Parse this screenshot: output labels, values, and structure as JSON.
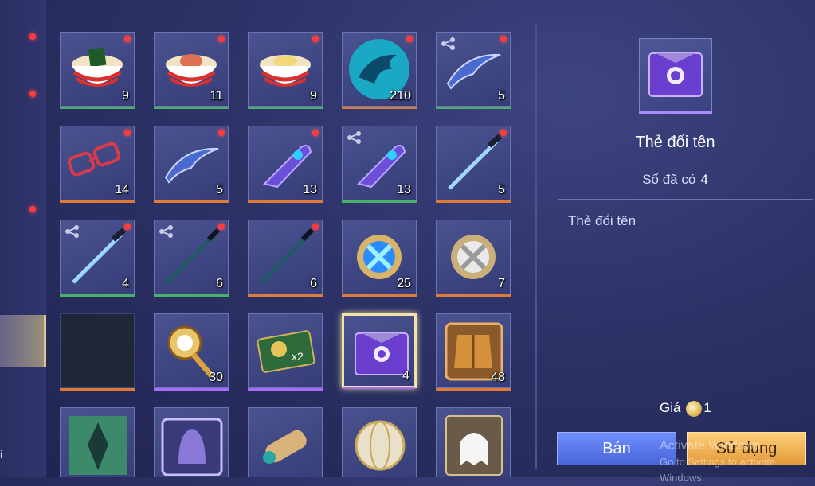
{
  "sidebar": {
    "letter": "i"
  },
  "items": [
    {
      "count": "9",
      "bar": "#4caf6a",
      "dot": true,
      "share": false,
      "icon": "seaweed-noodle-bowl-icon"
    },
    {
      "count": "11",
      "bar": "#4caf6a",
      "dot": true,
      "share": false,
      "icon": "salmon-noodle-bowl-icon"
    },
    {
      "count": "9",
      "bar": "#4caf6a",
      "dot": true,
      "share": false,
      "icon": "egg-noodle-bowl-icon"
    },
    {
      "count": "210",
      "bar": "#e07a3a",
      "dot": true,
      "share": false,
      "icon": "dragon-emblem-icon"
    },
    {
      "count": "5",
      "bar": "#4caf6a",
      "dot": true,
      "share": true,
      "icon": "curved-blade-icon"
    },
    {
      "count": "14",
      "bar": "#e07a3a",
      "dot": true,
      "share": false,
      "icon": "red-glasses-icon"
    },
    {
      "count": "5",
      "bar": "#e07a3a",
      "dot": true,
      "share": false,
      "icon": "curved-blade-icon"
    },
    {
      "count": "13",
      "bar": "#e07a3a",
      "dot": true,
      "share": false,
      "icon": "earpiece-icon"
    },
    {
      "count": "13",
      "bar": "#4caf6a",
      "dot": false,
      "share": true,
      "icon": "earpiece-icon"
    },
    {
      "count": "5",
      "bar": "#e07a3a",
      "dot": true,
      "share": false,
      "icon": "sword-icon"
    },
    {
      "count": "4",
      "bar": "#4caf6a",
      "dot": true,
      "share": true,
      "icon": "sword-icon"
    },
    {
      "count": "6",
      "bar": "#4caf6a",
      "dot": true,
      "share": true,
      "icon": "dark-blade-icon"
    },
    {
      "count": "6",
      "bar": "#e07a3a",
      "dot": true,
      "share": false,
      "icon": "dark-blade-icon"
    },
    {
      "count": "25",
      "bar": "#e07a3a",
      "dot": false,
      "share": false,
      "icon": "blue-orb-icon"
    },
    {
      "count": "7",
      "bar": "#e07a3a",
      "dot": false,
      "share": false,
      "icon": "silver-orb-icon"
    },
    {
      "count": "",
      "bar": "#e07a3a",
      "dot": false,
      "share": false,
      "icon": "empty-slot",
      "empty": true
    },
    {
      "count": "30",
      "bar": "#a86bff",
      "dot": false,
      "share": false,
      "icon": "golden-scepter-icon"
    },
    {
      "count": "",
      "bar": "#a86bff",
      "dot": false,
      "share": false,
      "icon": "coin-ticket-x2-icon",
      "label": "x2"
    },
    {
      "count": "4",
      "bar": "#a86bff",
      "dot": false,
      "share": false,
      "icon": "rename-card-icon",
      "selected": true
    },
    {
      "count": "48",
      "bar": "#e07a3a",
      "dot": false,
      "share": false,
      "icon": "armor-chest-icon"
    },
    {
      "count": "",
      "bar": "#e07a3a",
      "dot": false,
      "share": false,
      "icon": "green-emblem-icon"
    },
    {
      "count": "",
      "bar": "#e07a3a",
      "dot": false,
      "share": false,
      "icon": "knight-helmet-icon"
    },
    {
      "count": "",
      "bar": "#e07a3a",
      "dot": false,
      "share": false,
      "icon": "scroll-icon"
    },
    {
      "count": "",
      "bar": "#e07a3a",
      "dot": false,
      "share": false,
      "icon": "globe-orb-icon"
    },
    {
      "count": "",
      "bar": "#e07a3a",
      "dot": false,
      "share": false,
      "icon": "ghost-card-icon"
    }
  ],
  "detail": {
    "title": "Thẻ đổi tên",
    "owned_label": "Số đã có",
    "owned_value": "4",
    "description": "Thẻ đổi tên",
    "price_label": "Giá",
    "price_value": "1"
  },
  "buttons": {
    "sell": "Bán",
    "use": "Sử dụng"
  },
  "watermark": {
    "line1": "Activate Windows",
    "line2": "Go to Settings to activate Windows."
  }
}
